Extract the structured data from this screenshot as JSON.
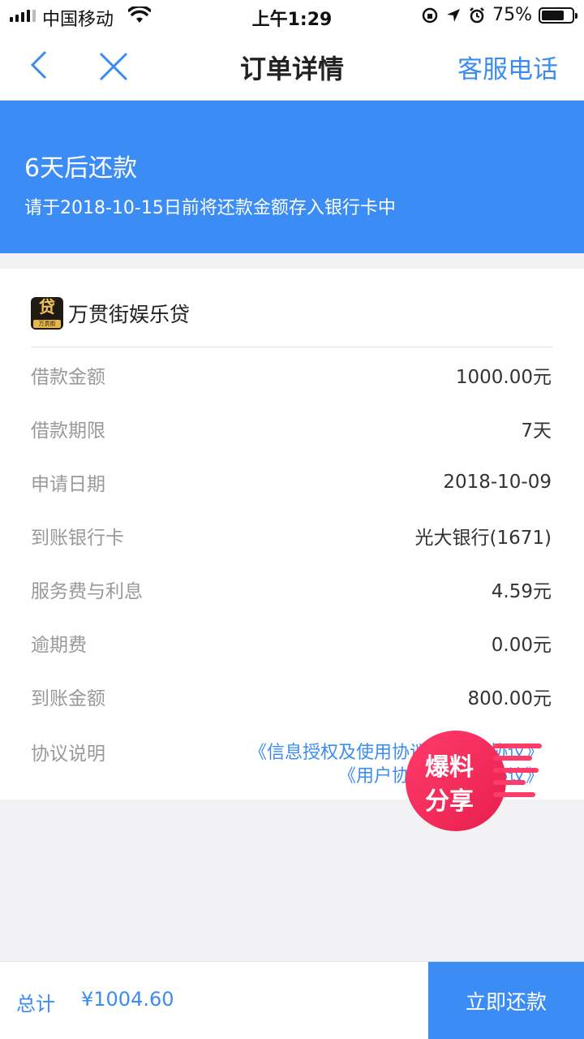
{
  "status_bar": {
    "carrier": "中国移动",
    "time": "上午1:29",
    "battery": "75%",
    "battery_level": 0.75
  },
  "nav": {
    "title": "订单详情",
    "service": "客服电话"
  },
  "banner": {
    "days": "6天后还款",
    "note": "请于2018-10-15日前将还款金额存入银行卡中"
  },
  "lender": {
    "logo_char": "贷",
    "logo_sub": "万贯街",
    "name": "万贯街娱乐贷"
  },
  "details": [
    {
      "label": "借款金额",
      "value": "1000.00元"
    },
    {
      "label": "借款期限",
      "value": "7天"
    },
    {
      "label": "申请日期",
      "value": "2018-10-09"
    },
    {
      "label": "到账银行卡",
      "value": "光大银行(1671)"
    },
    {
      "label": "服务费与利息",
      "value": "4.59元"
    },
    {
      "label": "逾期费",
      "value": "0.00元"
    },
    {
      "label": "到账金额",
      "value": "800.00元"
    }
  ],
  "agreement": {
    "label": "协议说明",
    "link1": "《信息授权及使用协议》《借款协议》",
    "link2": "《用户协议》《服务协议》"
  },
  "watermark": {
    "line1": "爆料",
    "line2": "分享"
  },
  "bottom": {
    "total_label": "总计",
    "total": "¥1004.60",
    "pay_button": "立即还款"
  },
  "colors": {
    "accent": "#3c8cf5",
    "link": "#3b8cf2",
    "watermark": "#ff3b6a"
  }
}
